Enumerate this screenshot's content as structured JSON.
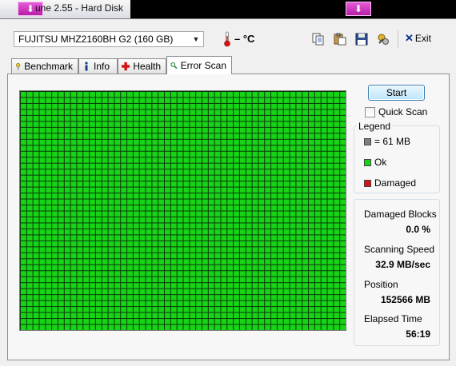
{
  "window": {
    "title": "une 2.55 - Hard Disk"
  },
  "toolbar": {
    "drive": "FUJITSU MHZ2160BH G2 (160 GB)",
    "temperature": "– °C",
    "exit_label": "Exit"
  },
  "tabs": [
    {
      "label": "Benchmark",
      "icon": "benchmark-icon"
    },
    {
      "label": "Info",
      "icon": "info-icon"
    },
    {
      "label": "Health",
      "icon": "health-icon"
    },
    {
      "label": "Error Scan",
      "icon": "search-icon",
      "active": true
    }
  ],
  "scan": {
    "start_label": "Start",
    "quick_scan_label": "Quick Scan",
    "quick_scan_checked": false,
    "grid_columns": 52,
    "grid_rows": 40,
    "grid_ok_color": "#17d417",
    "grid_line_color": "#0b3a0b"
  },
  "legend": {
    "title": "Legend",
    "items": [
      {
        "label": "= 61 MB",
        "color": "#7f7f7f"
      },
      {
        "label": "Ok",
        "color": "#17d417"
      },
      {
        "label": "Damaged",
        "color": "#e01010"
      }
    ]
  },
  "stats": {
    "damaged_blocks_label": "Damaged Blocks",
    "damaged_blocks_value": "0.0 %",
    "speed_label": "Scanning Speed",
    "speed_value": "32.9 MB/sec",
    "position_label": "Position",
    "position_value": "152566 MB",
    "elapsed_label": "Elapsed Time",
    "elapsed_value": "56:19"
  }
}
